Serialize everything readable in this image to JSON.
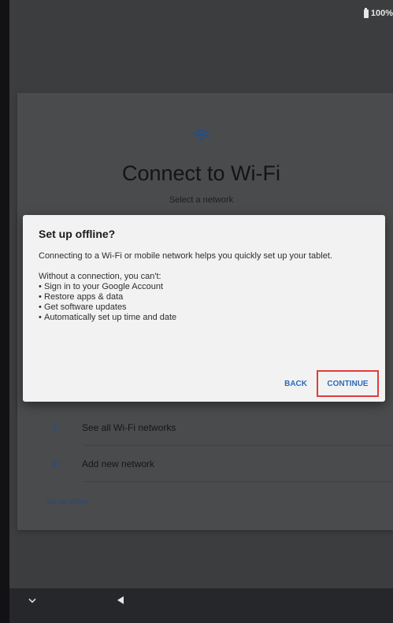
{
  "status_bar": {
    "battery_level": "100%"
  },
  "setup_page": {
    "icon": "wifi-icon",
    "title": "Connect to Wi-Fi",
    "subtitle": "Select a network",
    "actions": [
      {
        "icon": "plus-icon",
        "label": "See all Wi-Fi networks"
      },
      {
        "icon": "plus-icon",
        "label": "Add new network"
      }
    ],
    "offline_link": "Set up offline"
  },
  "dialog": {
    "title": "Set up offline?",
    "message": "Connecting to a Wi-Fi or mobile network helps you quickly set up your tablet.",
    "lead": "Without a connection, you can't:",
    "bullets": [
      "Sign in to your Google Account",
      "Restore apps & data",
      "Get software updates",
      "Automatically set up time and date"
    ],
    "back_label": "BACK",
    "continue_label": "CONTINUE"
  },
  "nav_bar": {
    "icons": [
      "chevron-down-icon",
      "back-icon"
    ]
  },
  "colors": {
    "accent": "#2d6bbd",
    "highlight": "#e03c3c",
    "dialog_bg": "#f2f2f2",
    "screen_bg": "#3c3d3f"
  }
}
